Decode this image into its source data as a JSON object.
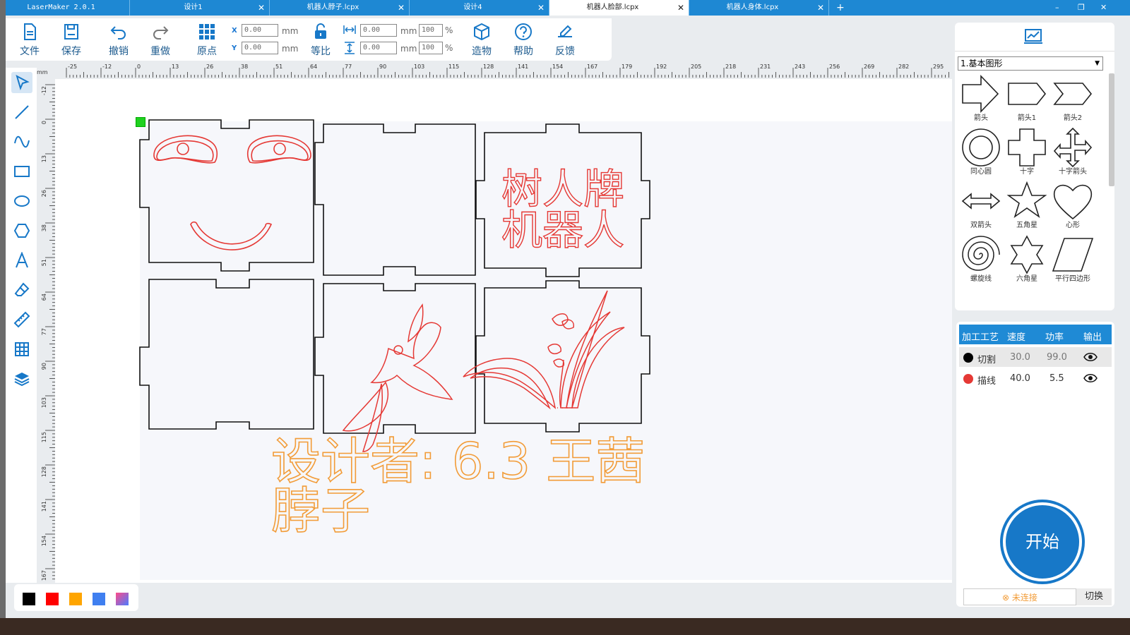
{
  "tabs": [
    {
      "title": "LaserMaker 2.0.1"
    },
    {
      "title": "设计1"
    },
    {
      "title": "机器人脖子.lcpx"
    },
    {
      "title": "设计4"
    },
    {
      "title": "机器人脸部.lcpx"
    },
    {
      "title": "机器人身体.lcpx"
    }
  ],
  "window": {
    "minimize": "–",
    "restore": "❐",
    "close": "✕",
    "add_tab": "+"
  },
  "toolbar": {
    "file": "文件",
    "save": "保存",
    "undo": "撤销",
    "redo": "重做",
    "origin": "原点",
    "x_label": "X",
    "y_label": "Y",
    "x_value": "0.00",
    "y_value": "0.00",
    "unit": "mm",
    "lock": "等比",
    "w_value": "0.00",
    "h_value": "0.00",
    "w_pct": "100",
    "h_pct": "100",
    "pct": "%",
    "make": "造物",
    "help": "帮助",
    "feedback": "反馈"
  },
  "ruler": {
    "h_ticks": [
      "-25",
      "-12",
      "0",
      "13",
      "26",
      "38",
      "51",
      "64",
      "77",
      "90",
      "103",
      "115",
      "128",
      "141",
      "154",
      "167",
      "179",
      "192",
      "205",
      "218",
      "231",
      "243",
      "256",
      "269",
      "282",
      "295"
    ],
    "v_ticks": [
      "-12",
      "0",
      "13",
      "26",
      "38",
      "51",
      "64",
      "77",
      "90",
      "103",
      "115",
      "128",
      "141",
      "154",
      "167"
    ],
    "corner": "mm"
  },
  "canvas": {
    "text_box": "树人牌\n机器人",
    "designer_line1": "设计者: 6.3 王茜",
    "designer_line2": "脖子"
  },
  "shapes_panel": {
    "category": "1.基本图形",
    "items": [
      "箭头",
      "箭头1",
      "箭头2",
      "同心圆",
      "十字",
      "十字箭头",
      "双箭头",
      "五角星",
      "心形",
      "螺旋线",
      "六角星",
      "平行四边形"
    ]
  },
  "layers": {
    "headers": [
      "加工工艺",
      "速度",
      "功率",
      "输出"
    ],
    "rows": [
      {
        "name": "切割",
        "speed": "30.0",
        "power": "99.0",
        "color": "#000000"
      },
      {
        "name": "描线",
        "speed": "40.0",
        "power": "5.5",
        "color": "#e53935"
      }
    ]
  },
  "start_button": "开始",
  "connection": {
    "status": "未连接",
    "switch": "切换"
  },
  "palette": [
    "#000000",
    "#ff0000",
    "#ffa500",
    "#3f7ff0",
    "gradient"
  ],
  "colors": {
    "accent": "#1e88d3",
    "cut": "#000000",
    "line": "#e53935",
    "text": "#f29c38"
  }
}
